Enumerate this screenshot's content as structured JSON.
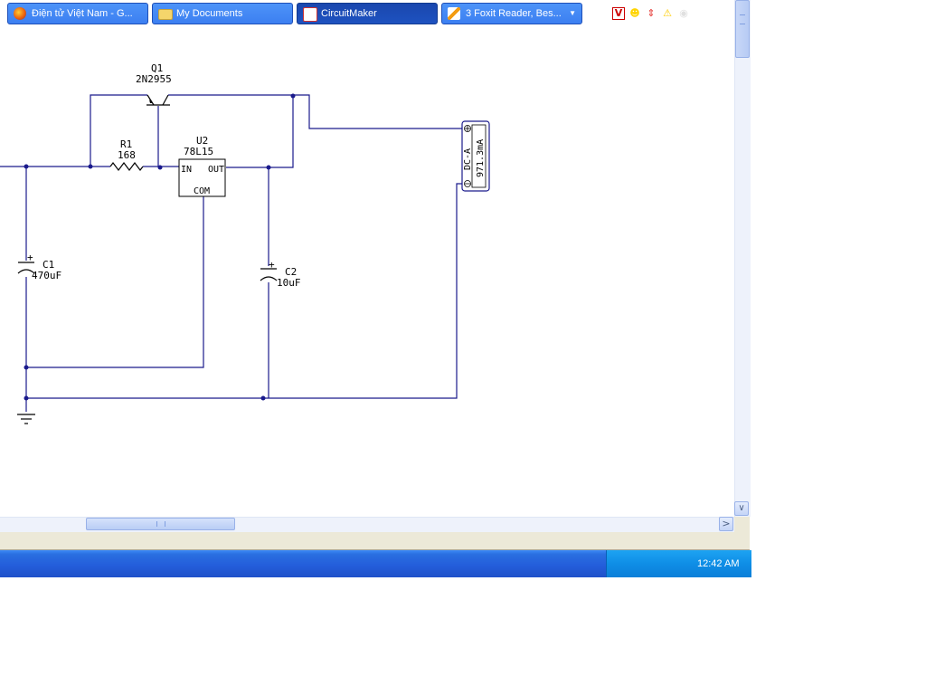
{
  "schematic": {
    "components": {
      "q1": {
        "ref": "Q1",
        "value": "2N2955"
      },
      "r1": {
        "ref": "R1",
        "value": "168"
      },
      "u2": {
        "ref": "U2",
        "value": "78L15",
        "pin_in": "IN",
        "pin_out": "OUT",
        "pin_com": "COM"
      },
      "c1": {
        "ref": "C1",
        "value": "470uF",
        "polarity": "+"
      },
      "c2": {
        "ref": "C2",
        "value": "10uF",
        "polarity": "+"
      },
      "meter": {
        "mode": "DC-A",
        "reading": "971.3mA"
      }
    },
    "wire_color": "#1a1a8c"
  },
  "taskbar": {
    "tasks": [
      {
        "label": "Điện tử Việt Nam - G...",
        "icon": "firefox-icon"
      },
      {
        "label": "My Documents",
        "icon": "folder-icon"
      },
      {
        "label": "CircuitMaker",
        "icon": "circuitmaker-icon",
        "active": true
      },
      {
        "label": "3 Foxit Reader, Bes...",
        "icon": "foxit-icon"
      }
    ],
    "clock": "12:42 AM"
  }
}
